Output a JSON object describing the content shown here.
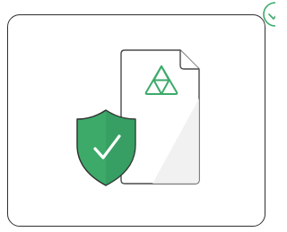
{
  "illustration": {
    "document_icon": "app-document-icon",
    "logo_icon": "triangle-logo-icon",
    "shield_icon": "shield-check-icon",
    "corner_icon": "circle-check-icon"
  },
  "colors": {
    "outline": "#2f2f2f",
    "accent_green": "#3daa6a",
    "accent_green_dark": "#2e8d55",
    "document_stroke": "#4a4a4a",
    "document_fill": "#ffffff",
    "document_shade": "#eeeeee"
  }
}
